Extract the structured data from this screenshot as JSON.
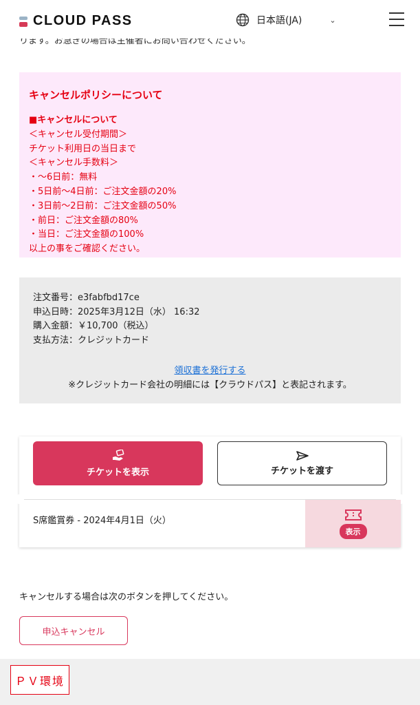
{
  "header": {
    "logo_text": "CLOUD PASS",
    "language": "日本語(JA)"
  },
  "top_clipped_text": "ります。お急ぎの場合は主催者にお問い合わせください。",
  "policy": {
    "title": "キャンセルポリシーについて",
    "lines": [
      "■キャンセルについて",
      "＜キャンセル受付期間＞",
      "チケット利用日の当日まで",
      "＜キャンセル手数料＞",
      "・〜6日前：無料",
      "・5日前〜4日前：ご注文金額の20%",
      "・3日前〜2日前：ご注文金額の50%",
      "・前日：ご注文金額の80%",
      "・当日：ご注文金額の100%",
      "以上の事をご確認ください。"
    ]
  },
  "order": {
    "number": "注文番号：e3fabfbd17ce",
    "date": "申込日時：2025年3月12日（水） 16:32",
    "amount": "購入金額：￥10,700（税込）",
    "payment": "支払方法：クレジットカード",
    "receipt_link": "領収書を発行する",
    "card_note": "※クレジットカード会社の明細には【クラウドパス】と表記されます。"
  },
  "ticket": {
    "show_button": "チケットを表示",
    "pass_button": "チケットを渡す",
    "name": "S席鑑賞券 - 2024年4月1日（火）",
    "badge": "表示"
  },
  "cancel": {
    "instruction": "キャンセルする場合は次のボタンを押してください。",
    "button": "申込キャンセル"
  },
  "footer": {
    "env_label": "ＰＶ環境"
  },
  "colors": {
    "accent": "#d8375c",
    "policy_bg": "#fde9fb",
    "policy_text": "#e50012",
    "order_bg": "#ebebeb",
    "link": "#1a6fd6"
  },
  "icons": [
    "globe-icon",
    "chevron-down-icon",
    "menu-icon",
    "hand-ticket-icon",
    "send-icon",
    "ticket-icon"
  ]
}
